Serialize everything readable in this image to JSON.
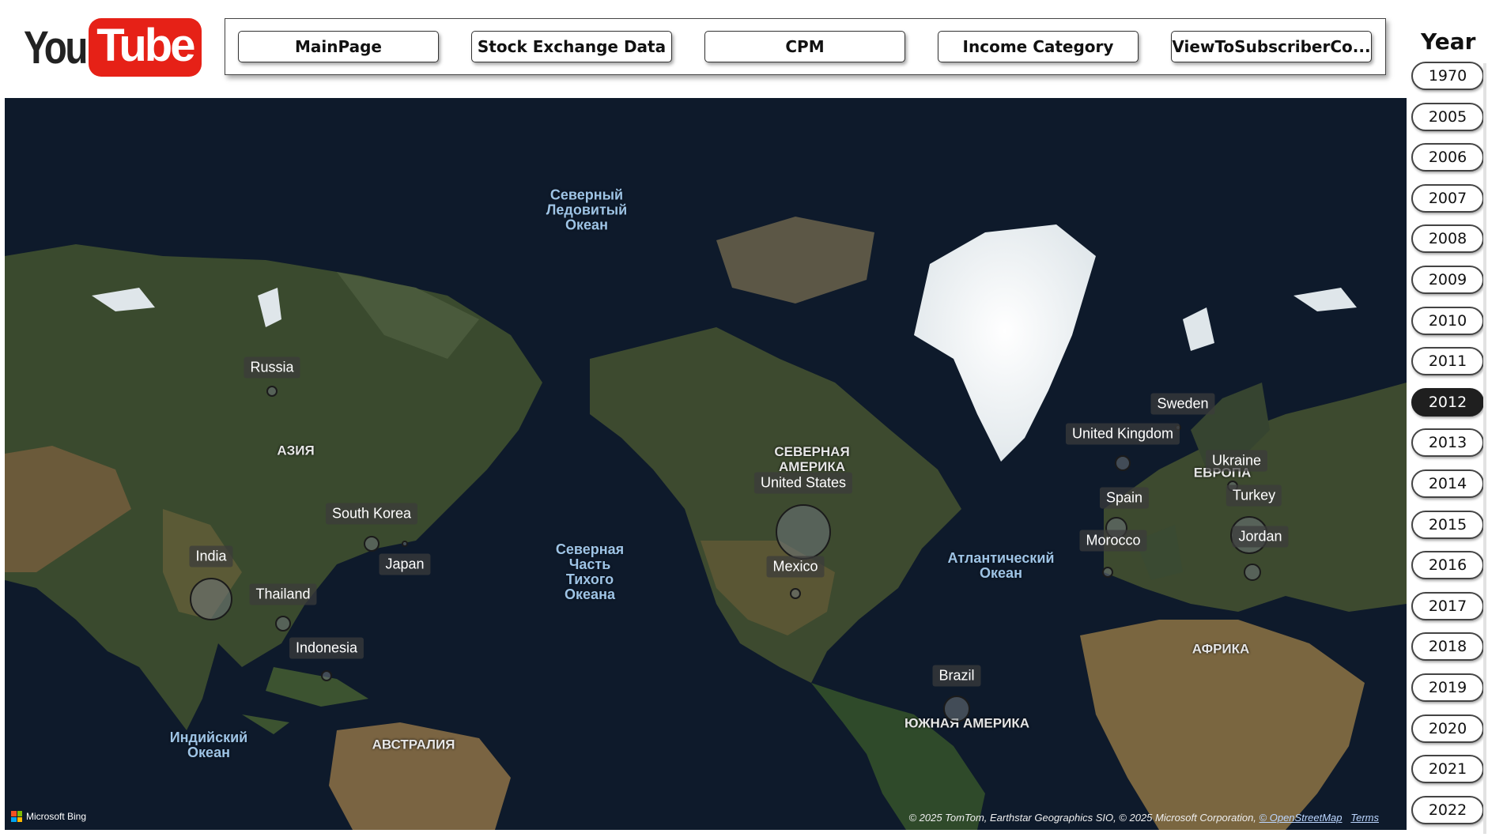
{
  "logo": {
    "part1": "You",
    "part2": "Tube"
  },
  "nav": {
    "buttons": [
      "MainPage",
      "Stock Exchange Data",
      "CPM",
      "Income Category",
      "ViewToSubscriberCo..."
    ]
  },
  "year_slicer": {
    "title": "Year",
    "selected": "2012",
    "years": [
      "1970",
      "2005",
      "2006",
      "2007",
      "2008",
      "2009",
      "2010",
      "2011",
      "2012",
      "2013",
      "2014",
      "2015",
      "2016",
      "2017",
      "2018",
      "2019",
      "2020",
      "2021",
      "2022"
    ]
  },
  "map": {
    "oceans": [
      {
        "text": "Северный\nЛедовитый\nОкеан"
      },
      {
        "text": "Северная\nЧасть\nТихого\nОкеана"
      },
      {
        "text": "Атлантический\nОкеан"
      },
      {
        "text": "Индийский\nОкеан"
      }
    ],
    "continents": [
      {
        "text": "АЗИЯ"
      },
      {
        "text": "СЕВЕРНАЯ\nАМЕРИКА"
      },
      {
        "text": "ЕВРОПА"
      },
      {
        "text": "АФРИКА"
      },
      {
        "text": "ЮЖНАЯ АМЕРИКА"
      },
      {
        "text": "АВСТРАЛИЯ"
      }
    ],
    "countries": [
      {
        "name": "Russia"
      },
      {
        "name": "South Korea"
      },
      {
        "name": "Japan"
      },
      {
        "name": "India"
      },
      {
        "name": "Thailand"
      },
      {
        "name": "Indonesia"
      },
      {
        "name": "United States"
      },
      {
        "name": "Mexico"
      },
      {
        "name": "Brazil"
      },
      {
        "name": "Sweden"
      },
      {
        "name": "United Kingdom"
      },
      {
        "name": "Ukraine"
      },
      {
        "name": "Spain"
      },
      {
        "name": "Turkey"
      },
      {
        "name": "Morocco"
      },
      {
        "name": "Jordan"
      }
    ],
    "provider": "Microsoft Bing",
    "attribution": "© 2025 TomTom, Earthstar Geographics SIO, © 2025 Microsoft Corporation,",
    "attribution_link": "© OpenStreetMap",
    "terms_link": "Terms"
  },
  "colors": {
    "youtube_red": "#e62117",
    "ocean": "#0e1a2b",
    "selected_pill": "#1f1f1f"
  }
}
